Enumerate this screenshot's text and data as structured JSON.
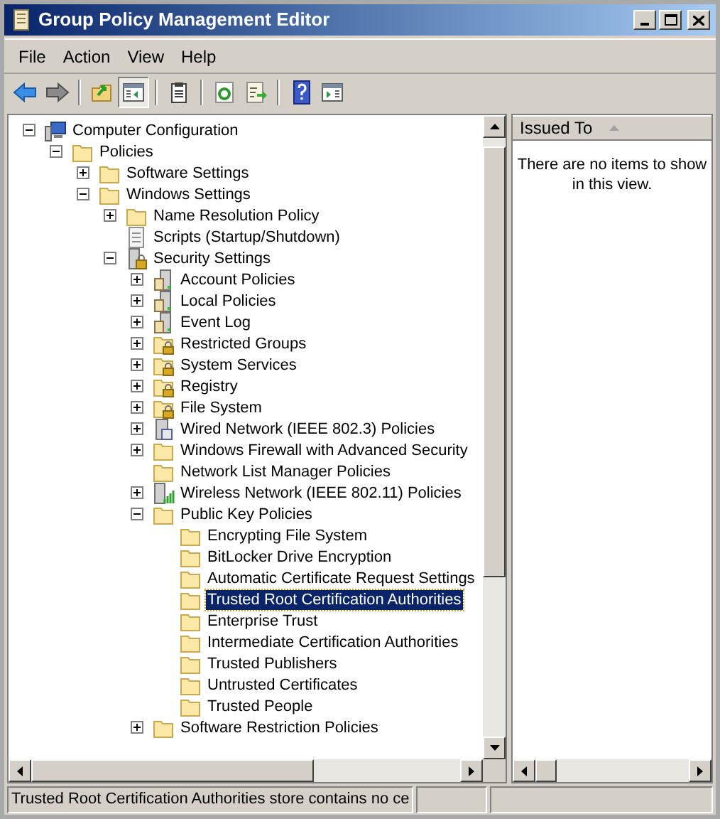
{
  "window": {
    "title": "Group Policy Management Editor"
  },
  "menu": [
    {
      "label": "File"
    },
    {
      "label": "Action"
    },
    {
      "label": "View"
    },
    {
      "label": "Help"
    }
  ],
  "toolbar": [
    {
      "kind": "back",
      "pressed": false
    },
    {
      "kind": "forward",
      "pressed": false
    },
    {
      "kind": "sep"
    },
    {
      "kind": "up",
      "pressed": false
    },
    {
      "kind": "tree",
      "pressed": true
    },
    {
      "kind": "sep"
    },
    {
      "kind": "clipboard",
      "pressed": false
    },
    {
      "kind": "sep"
    },
    {
      "kind": "refresh",
      "pressed": false
    },
    {
      "kind": "export",
      "pressed": false
    },
    {
      "kind": "sep"
    },
    {
      "kind": "help",
      "pressed": false
    },
    {
      "kind": "pane",
      "pressed": false
    }
  ],
  "tree": [
    {
      "label": "Computer Configuration",
      "kind": "computer",
      "expanded": true,
      "selected": false,
      "children": [
        {
          "label": "Policies",
          "kind": "folder",
          "expanded": true,
          "selected": false,
          "children": [
            {
              "label": "Software Settings",
              "kind": "folder",
              "expanded": false,
              "selected": false
            },
            {
              "label": "Windows Settings",
              "kind": "folder",
              "expanded": true,
              "selected": false,
              "children": [
                {
                  "label": "Name Resolution Policy",
                  "kind": "folder",
                  "expanded": false,
                  "selected": false
                },
                {
                  "label": "Scripts (Startup/Shutdown)",
                  "kind": "script",
                  "selected": false
                },
                {
                  "label": "Security Settings",
                  "kind": "security",
                  "expanded": true,
                  "selected": false,
                  "children": [
                    {
                      "label": "Account Policies",
                      "kind": "server",
                      "expanded": false,
                      "selected": false
                    },
                    {
                      "label": "Local Policies",
                      "kind": "server",
                      "expanded": false,
                      "selected": false
                    },
                    {
                      "label": "Event Log",
                      "kind": "server",
                      "expanded": false,
                      "selected": false
                    },
                    {
                      "label": "Restricted Groups",
                      "kind": "lockfolder",
                      "expanded": false,
                      "selected": false
                    },
                    {
                      "label": "System Services",
                      "kind": "lockfolder",
                      "expanded": false,
                      "selected": false
                    },
                    {
                      "label": "Registry",
                      "kind": "lockfolder",
                      "expanded": false,
                      "selected": false
                    },
                    {
                      "label": "File System",
                      "kind": "lockfolder",
                      "expanded": false,
                      "selected": false
                    },
                    {
                      "label": "Wired Network (IEEE 802.3) Policies",
                      "kind": "network",
                      "expanded": false,
                      "selected": false
                    },
                    {
                      "label": "Windows Firewall with Advanced Security",
                      "kind": "folder",
                      "expanded": false,
                      "selected": false
                    },
                    {
                      "label": "Network List Manager Policies",
                      "kind": "folder",
                      "selected": false
                    },
                    {
                      "label": "Wireless Network (IEEE 802.11) Policies",
                      "kind": "wireless",
                      "expanded": false,
                      "selected": false
                    },
                    {
                      "label": "Public Key Policies",
                      "kind": "folder",
                      "expanded": true,
                      "selected": false,
                      "children": [
                        {
                          "label": "Encrypting File System",
                          "kind": "folder",
                          "selected": false
                        },
                        {
                          "label": "BitLocker Drive Encryption",
                          "kind": "folder",
                          "selected": false
                        },
                        {
                          "label": "Automatic Certificate Request Settings",
                          "kind": "folder",
                          "selected": false
                        },
                        {
                          "label": "Trusted Root Certification Authorities",
                          "kind": "folder",
                          "selected": true
                        },
                        {
                          "label": "Enterprise Trust",
                          "kind": "folder",
                          "selected": false
                        },
                        {
                          "label": "Intermediate Certification Authorities",
                          "kind": "folder",
                          "selected": false
                        },
                        {
                          "label": "Trusted Publishers",
                          "kind": "folder",
                          "selected": false
                        },
                        {
                          "label": "Untrusted Certificates",
                          "kind": "folder",
                          "selected": false
                        },
                        {
                          "label": "Trusted People",
                          "kind": "folder",
                          "selected": false
                        }
                      ]
                    },
                    {
                      "label": "Software Restriction Policies",
                      "kind": "folder",
                      "expanded": false,
                      "selected": false
                    }
                  ]
                }
              ]
            }
          ]
        }
      ]
    }
  ],
  "details": {
    "column": "Issued To",
    "empty_message": "There are no items to show in this view."
  },
  "status_bar": {
    "text": "Trusted Root Certification Authorities store contains no ce"
  }
}
